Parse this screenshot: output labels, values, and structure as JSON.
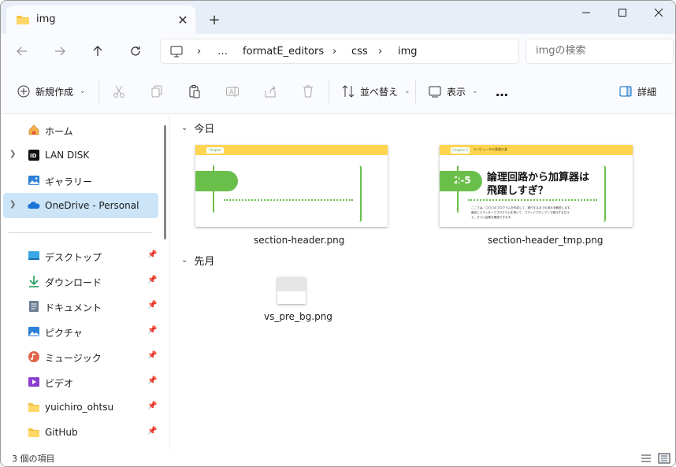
{
  "window": {
    "tab_title": "img",
    "tab_close": "✕",
    "new_tab": "+",
    "minimize": "─",
    "maximize": "☐",
    "close": "✕"
  },
  "address": {
    "breadcrumbs": [
      "…",
      "formatE_editors",
      "css",
      "img"
    ],
    "separator": "›",
    "search_placeholder": "imgの検索"
  },
  "toolbar": {
    "new_label": "新規作成",
    "sort_label": "並べ替え",
    "view_label": "表示",
    "more_label": "…",
    "details_label": "詳細"
  },
  "sidebar": {
    "items": [
      {
        "label": "ホーム",
        "icon": "home-icon"
      },
      {
        "label": "LAN DISK",
        "icon": "lan-disk-icon"
      },
      {
        "label": "ギャラリー",
        "icon": "gallery-icon"
      },
      {
        "label": "OneDrive - Personal",
        "icon": "onedrive-icon"
      },
      {
        "label": "デスクトップ",
        "icon": "desktop-icon"
      },
      {
        "label": "ダウンロード",
        "icon": "download-icon"
      },
      {
        "label": "ドキュメント",
        "icon": "document-icon"
      },
      {
        "label": "ピクチャ",
        "icon": "pictures-icon"
      },
      {
        "label": "ミュージック",
        "icon": "music-icon"
      },
      {
        "label": "ビデオ",
        "icon": "video-icon"
      },
      {
        "label": "yuichiro_ohtsu",
        "icon": "folder-icon"
      },
      {
        "label": "GitHub",
        "icon": "folder-icon"
      }
    ]
  },
  "content": {
    "group_today": "今日",
    "group_last_month": "先月",
    "files": [
      {
        "name": "section-header.png"
      },
      {
        "name": "section-header_tmp.png"
      },
      {
        "name": "vs_pre_bg.png"
      }
    ],
    "thumb2": {
      "chapter_tag": "Chapter 2",
      "chapter_sub": "コンピュータの基礎の基",
      "number": "2-5",
      "heading_line1": "論理回路から加算器は",
      "heading_line2": "飛躍しすぎ？",
      "body_line1": "ここでは、〇〇〇のプログラムを作成して、実行するまでの流れを解説します。",
      "body_line2": "最初にエディターでプログラムを書いて、コマンドプロンプトで実行するだけ",
      "body_line3": "で、すぐに結果を確認できます。"
    },
    "thumb1": {
      "chapter_tag": "Chapter"
    }
  },
  "status": {
    "count_text": "3 個の項目"
  },
  "colors": {
    "accent": "#0067c0",
    "selected": "#cce4f7",
    "thumb_yellow": "#ffd54f",
    "thumb_green": "#6abf4b"
  }
}
